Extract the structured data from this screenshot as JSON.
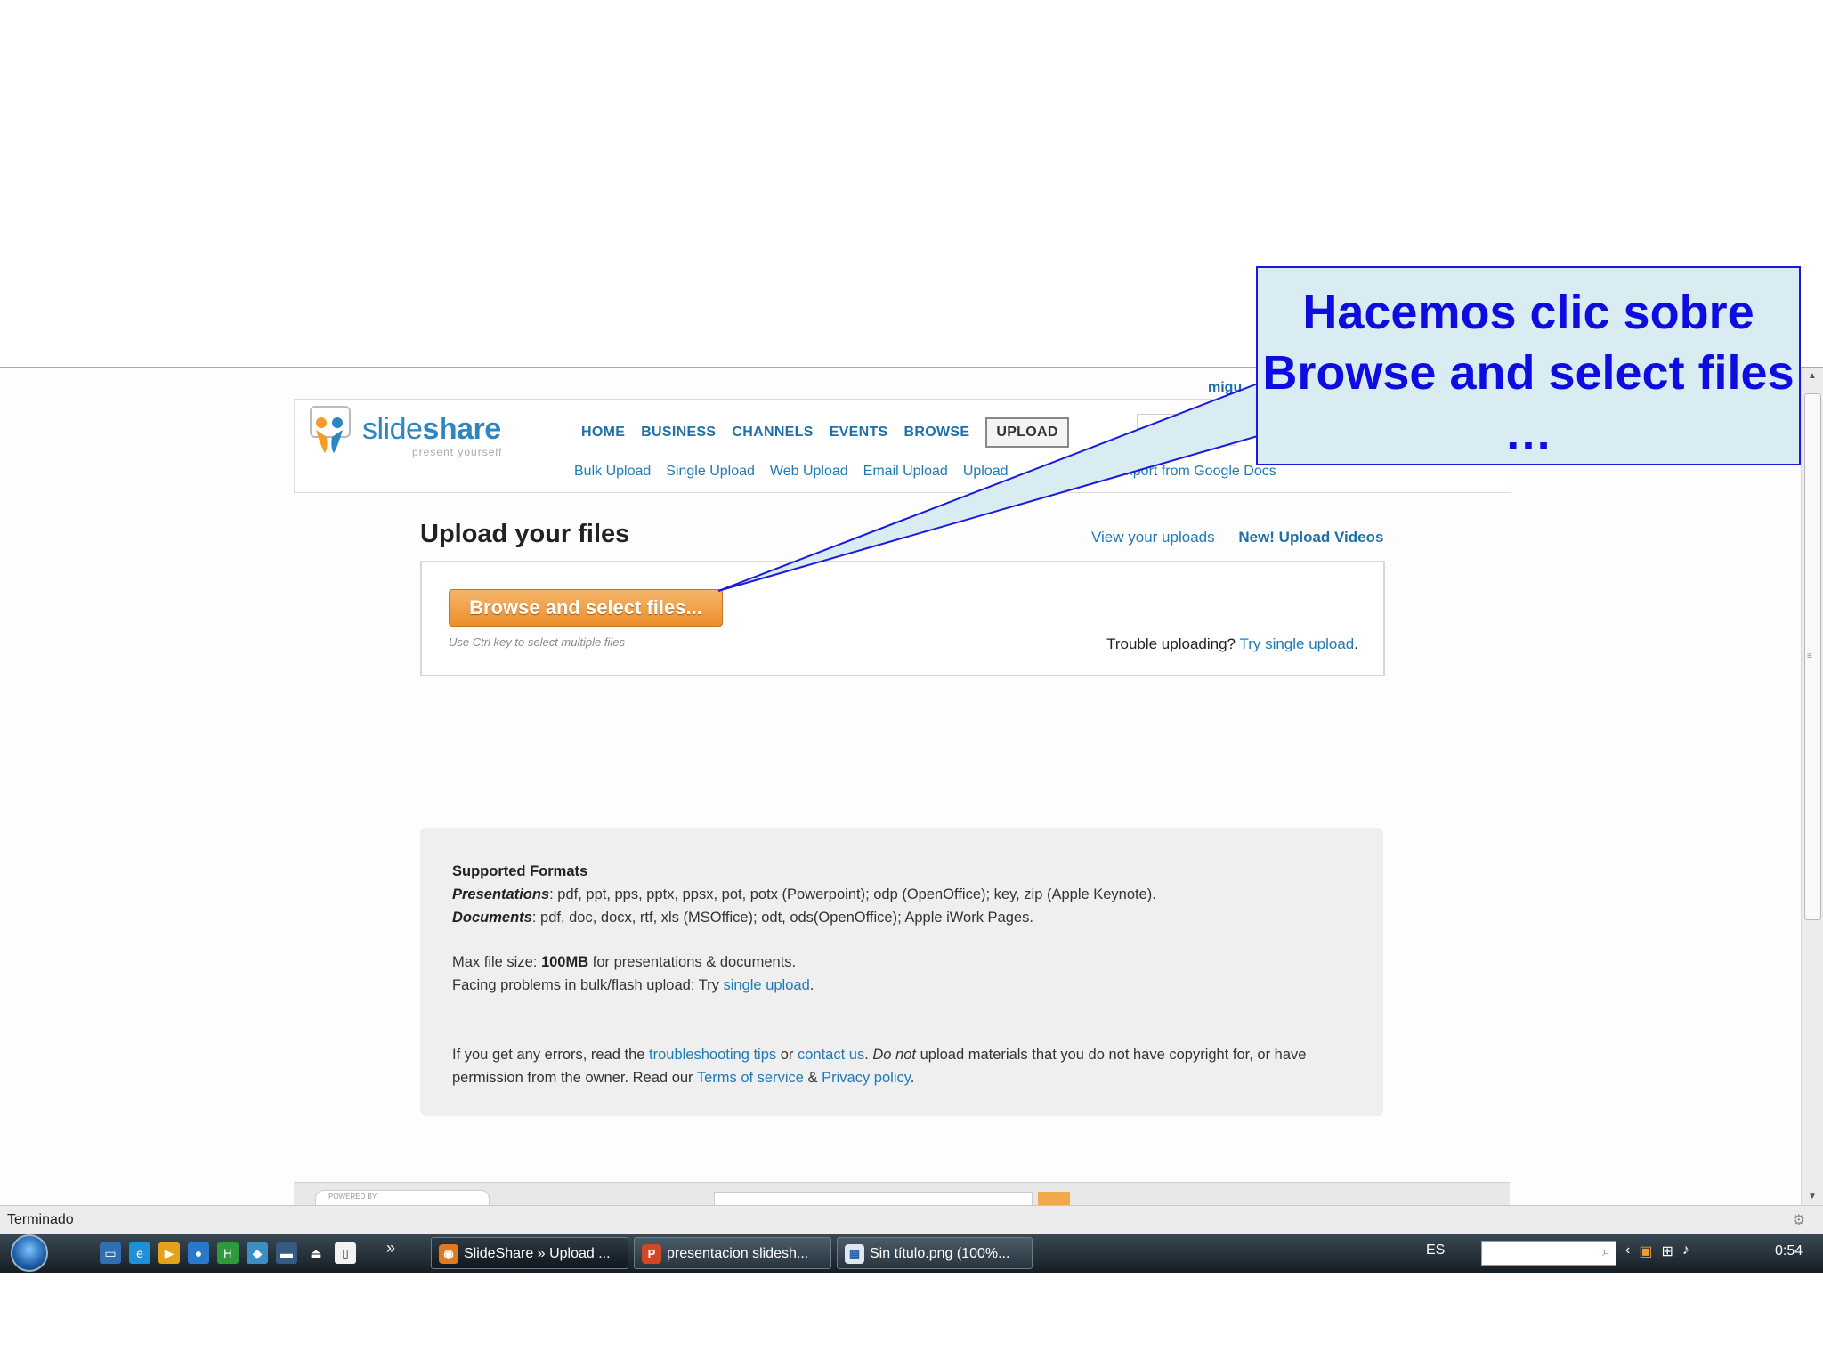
{
  "callout": {
    "text": "Hacemos clic sobre Browse and select files …"
  },
  "header": {
    "logo_text_a": "slide",
    "logo_text_b": "share",
    "logo_tagline": "present yourself",
    "user_partial": "migu",
    "nav": [
      "HOME",
      "BUSINESS",
      "CHANNELS",
      "EVENTS",
      "BROWSE"
    ],
    "upload_label": "UPLOAD",
    "subnav": [
      "Bulk Upload",
      "Single Upload",
      "Web Upload",
      "Email Upload",
      "Upload"
    ],
    "subnav_gdocs": "Import from Google Docs"
  },
  "page": {
    "title": "Upload your files",
    "view_uploads": "View your uploads",
    "upload_videos": "New! Upload Videos",
    "browse_button": "Browse and select files...",
    "hint": "Use Ctrl key to select multiple files",
    "trouble_text": "Trouble uploading?",
    "trouble_link": "Try single upload",
    "trouble_end": "."
  },
  "formats": {
    "heading": "Supported Formats",
    "pres_label": "Presentations",
    "pres_text": ": pdf, ppt, pps, pptx, ppsx, pot, potx (Powerpoint); odp (OpenOffice); key, zip (Apple Keynote).",
    "docs_label": "Documents",
    "docs_text": ": pdf, doc, docx, rtf, xls (MSOffice); odt, ods(OpenOffice); Apple iWork Pages.",
    "max_pre": "Max file size: ",
    "max_val": "100MB",
    "max_post": " for presentations & documents.",
    "facing_pre": "Facing problems in bulk/flash upload: Try ",
    "facing_link": "single upload",
    "facing_post": ".",
    "err_1": "If you get any errors, read the ",
    "err_link1": "troubleshooting tips",
    "err_2": " or ",
    "err_link2": "contact us",
    "err_3": ". ",
    "err_em": "Do not",
    "err_4": " upload materials that you do not have copyright for, or have",
    "err_5": "permission from the owner. Read our ",
    "err_link3": "Terms of service",
    "err_6": " & ",
    "err_link4": "Privacy policy",
    "err_7": ".",
    "powered": "POWERED BY"
  },
  "status": {
    "text": "Terminado"
  },
  "taskbar": {
    "tasks": [
      "SlideShare » Upload ...",
      "presentacion slidesh...",
      "Sin título.png (100%..."
    ],
    "lang": "ES",
    "clock": "0:54"
  },
  "colors": {
    "accent_link": "#1f7ab5",
    "callout_text": "#0d0de0",
    "callout_bg": "#d8ecf2",
    "button_orange": "#ec8e2b"
  }
}
